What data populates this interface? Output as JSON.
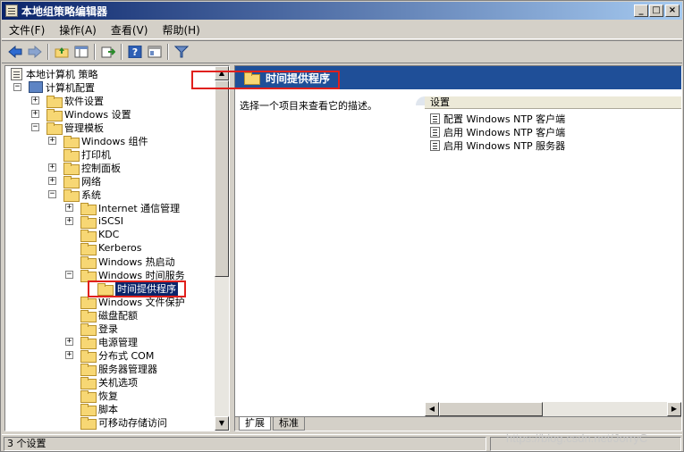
{
  "window": {
    "title": "本地组策略编辑器",
    "buttons": [
      "_",
      "□",
      "×"
    ]
  },
  "menu": [
    "文件(F)",
    "操作(A)",
    "查看(V)",
    "帮助(H)"
  ],
  "toolbar": {
    "icons": [
      "back-icon",
      "forward-icon",
      "up-folder-icon",
      "show-hide-tree-icon",
      "export-icon",
      "help-icon",
      "properties-icon",
      "filter-icon"
    ]
  },
  "tree": {
    "root": "本地计算机 策略",
    "items": [
      {
        "label": "计算机配置",
        "level": 1,
        "expander": "−",
        "icon": "computer"
      },
      {
        "label": "软件设置",
        "level": 2,
        "expander": "+"
      },
      {
        "label": "Windows 设置",
        "level": 2,
        "expander": "+"
      },
      {
        "label": "管理模板",
        "level": 2,
        "expander": "−"
      },
      {
        "label": "Windows 组件",
        "level": 3,
        "expander": "+"
      },
      {
        "label": "打印机",
        "level": 3,
        "expander": ""
      },
      {
        "label": "控制面板",
        "level": 3,
        "expander": "+"
      },
      {
        "label": "网络",
        "level": 3,
        "expander": "+"
      },
      {
        "label": "系统",
        "level": 3,
        "expander": "−"
      },
      {
        "label": "Internet 通信管理",
        "level": 4,
        "expander": "+"
      },
      {
        "label": "iSCSI",
        "level": 4,
        "expander": "+"
      },
      {
        "label": "KDC",
        "level": 4,
        "expander": ""
      },
      {
        "label": "Kerberos",
        "level": 4,
        "expander": ""
      },
      {
        "label": "Windows 热启动",
        "level": 4,
        "expander": ""
      },
      {
        "label": "Windows 时间服务",
        "level": 4,
        "expander": "−"
      },
      {
        "label": "时间提供程序",
        "level": 5,
        "expander": "",
        "selected": true
      },
      {
        "label": "Windows 文件保护",
        "level": 4,
        "expander": ""
      },
      {
        "label": "磁盘配额",
        "level": 4,
        "expander": ""
      },
      {
        "label": "登录",
        "level": 4,
        "expander": ""
      },
      {
        "label": "电源管理",
        "level": 4,
        "expander": "+"
      },
      {
        "label": "分布式 COM",
        "level": 4,
        "expander": "+"
      },
      {
        "label": "服务器管理器",
        "level": 4,
        "expander": ""
      },
      {
        "label": "关机选项",
        "level": 4,
        "expander": ""
      },
      {
        "label": "恢复",
        "level": 4,
        "expander": ""
      },
      {
        "label": "脚本",
        "level": 4,
        "expander": ""
      },
      {
        "label": "可移动存储访问",
        "level": 4,
        "expander": ""
      }
    ]
  },
  "details": {
    "header": "时间提供程序",
    "description": "选择一个项目来查看它的描述。",
    "column": "设置",
    "settings": [
      "配置 Windows NTP 客户端",
      "启用 Windows NTP 客户端",
      "启用 Windows NTP 服务器"
    ],
    "tabs": [
      "扩展",
      "标准"
    ]
  },
  "status": {
    "text": "3 个设置"
  },
  "watermark": "https://blog.csdn.net/JorryC",
  "colors": {
    "titlebar": "#0a246a",
    "header": "#1f4f98",
    "highlight": "#e0201c",
    "selection": "#0a246a"
  }
}
